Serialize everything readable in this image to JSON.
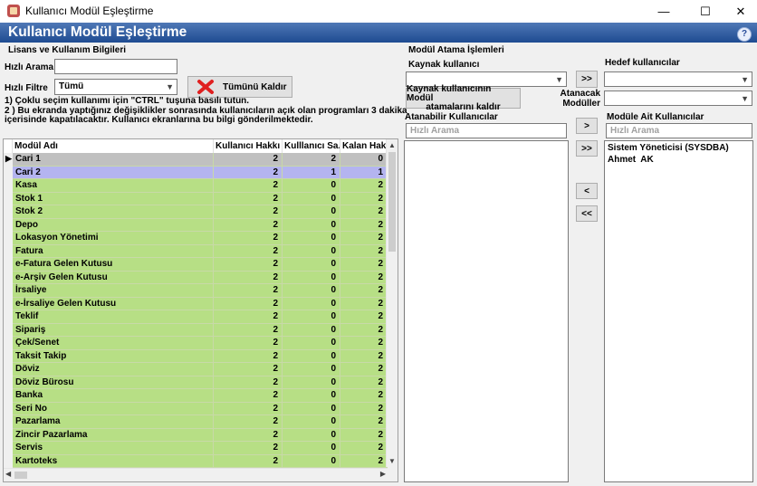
{
  "window": {
    "title": "Kullanıcı Modül Eşleştirme",
    "minimize": "—",
    "maximize": "☐",
    "close": "✕"
  },
  "header": {
    "title": "Kullanıcı Modül Eşleştirme",
    "help": "?"
  },
  "license": {
    "section_title": "Lisans ve Kullanım Bilgileri",
    "quick_search_label": "Hızlı Arama",
    "quick_search_value": "",
    "quick_filter_label": "Hızlı Filtre",
    "quick_filter_value": "Tümü",
    "remove_all_button": "Tümünü Kaldır",
    "info_line1": "1) Çoklu seçim kullanımı için \"CTRL\" tuşuna basılı tutun.",
    "info_line2": "2 ) Bu ekranda yaptığınız değişiklikler sonrasında kullanıcıların açık olan programları 3 dakika",
    "info_line3": "içerisinde kapatılacaktır. Kullanıcı ekranlarına bu bilgi gönderilmektedir."
  },
  "grid": {
    "columns": [
      "Modül Adı",
      "Kullanıcı Hakkı",
      "Kulllanıcı Sa...",
      "Kalan Hak"
    ],
    "rows": [
      {
        "name": "Cari 1",
        "hak": "2",
        "sayi": "2",
        "kalan": "0",
        "state": "selected"
      },
      {
        "name": "Cari 2",
        "hak": "2",
        "sayi": "1",
        "kalan": "1",
        "state": "partial"
      },
      {
        "name": "Kasa",
        "hak": "2",
        "sayi": "0",
        "kalan": "2",
        "state": "free"
      },
      {
        "name": "Stok 1",
        "hak": "2",
        "sayi": "0",
        "kalan": "2",
        "state": "free"
      },
      {
        "name": "Stok 2",
        "hak": "2",
        "sayi": "0",
        "kalan": "2",
        "state": "free"
      },
      {
        "name": "Depo",
        "hak": "2",
        "sayi": "0",
        "kalan": "2",
        "state": "free"
      },
      {
        "name": "Lokasyon Yönetimi",
        "hak": "2",
        "sayi": "0",
        "kalan": "2",
        "state": "free"
      },
      {
        "name": "Fatura",
        "hak": "2",
        "sayi": "0",
        "kalan": "2",
        "state": "free"
      },
      {
        "name": "e-Fatura Gelen Kutusu",
        "hak": "2",
        "sayi": "0",
        "kalan": "2",
        "state": "free"
      },
      {
        "name": "e-Arşiv Gelen Kutusu",
        "hak": "2",
        "sayi": "0",
        "kalan": "2",
        "state": "free"
      },
      {
        "name": "İrsaliye",
        "hak": "2",
        "sayi": "0",
        "kalan": "2",
        "state": "free"
      },
      {
        "name": "e-İrsaliye Gelen Kutusu",
        "hak": "2",
        "sayi": "0",
        "kalan": "2",
        "state": "free"
      },
      {
        "name": "Teklif",
        "hak": "2",
        "sayi": "0",
        "kalan": "2",
        "state": "free"
      },
      {
        "name": "Sipariş",
        "hak": "2",
        "sayi": "0",
        "kalan": "2",
        "state": "free"
      },
      {
        "name": "Çek/Senet",
        "hak": "2",
        "sayi": "0",
        "kalan": "2",
        "state": "free"
      },
      {
        "name": "Taksit Takip",
        "hak": "2",
        "sayi": "0",
        "kalan": "2",
        "state": "free"
      },
      {
        "name": "Döviz",
        "hak": "2",
        "sayi": "0",
        "kalan": "2",
        "state": "free"
      },
      {
        "name": "Döviz Bürosu",
        "hak": "2",
        "sayi": "0",
        "kalan": "2",
        "state": "free"
      },
      {
        "name": "Banka",
        "hak": "2",
        "sayi": "0",
        "kalan": "2",
        "state": "free"
      },
      {
        "name": "Seri No",
        "hak": "2",
        "sayi": "0",
        "kalan": "2",
        "state": "free"
      },
      {
        "name": "Pazarlama",
        "hak": "2",
        "sayi": "0",
        "kalan": "2",
        "state": "free"
      },
      {
        "name": "Zincir Pazarlama",
        "hak": "2",
        "sayi": "0",
        "kalan": "2",
        "state": "free"
      },
      {
        "name": "Servis",
        "hak": "2",
        "sayi": "0",
        "kalan": "2",
        "state": "free"
      },
      {
        "name": "Kartoteks",
        "hak": "2",
        "sayi": "0",
        "kalan": "2",
        "state": "free"
      }
    ],
    "colors": {
      "selected": "#c0c0c0",
      "partial": "#b4b4f0",
      "free": "#b7df85"
    }
  },
  "assign": {
    "section_title": "Modül Atama İşlemleri",
    "source_user_label": "Kaynak kullanıcı",
    "source_user_value": "",
    "copy_button": ">>",
    "target_users_label": "Hedef kullanıcılar",
    "target_users_value": "",
    "remove_source_button_line1": "Kaynak kullanıcının Modül",
    "remove_source_button_line2": "atamalarını kaldır",
    "modules_to_assign_label_line1": "Atanacak",
    "modules_to_assign_label_line2": "Modüller",
    "modules_to_assign_value": "",
    "assignable_users_title": "Atanabilir Kullanıcılar",
    "assignable_search_placeholder": "Hızlı Arama",
    "assignable_users": [],
    "module_users_title": "Modüle Ait Kullanıcılar",
    "module_search_placeholder": "Hızlı Arama",
    "module_users": [
      "Sistem Yöneticisi (SYSDBA)",
      "Ahmet  AK"
    ],
    "btn_add_one": ">",
    "btn_add_all": ">>",
    "btn_remove_one": "<",
    "btn_remove_all": "<<"
  },
  "icons": {
    "app": "app-icon",
    "help": "help-icon",
    "remove_all": "red-x-icon",
    "dropdown": "chevron-down-icon",
    "row_pointer": "row-pointer-icon",
    "scroll_up": "scroll-up-icon",
    "scroll_down": "scroll-down-icon",
    "scroll_left": "scroll-left-icon",
    "scroll_right": "scroll-right-icon"
  }
}
